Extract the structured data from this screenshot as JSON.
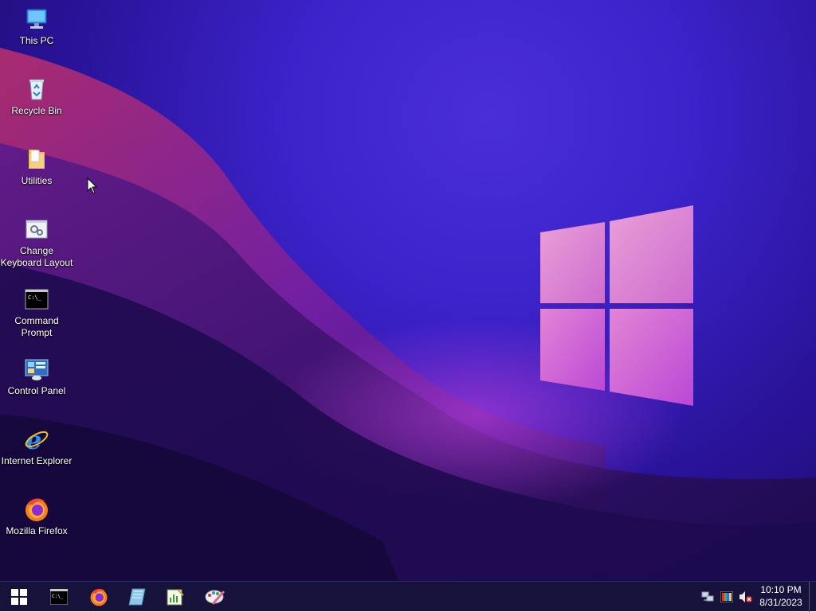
{
  "desktop_icons": [
    {
      "name": "this-pc",
      "label": "This PC",
      "icon": "computer-icon"
    },
    {
      "name": "recycle-bin",
      "label": "Recycle Bin",
      "icon": "recycle-bin-icon"
    },
    {
      "name": "utilities",
      "label": "Utilities",
      "icon": "folder-icon"
    },
    {
      "name": "change-keyboard-layout",
      "label": "Change\nKeyboard Layout",
      "icon": "settings-window-icon"
    },
    {
      "name": "command-prompt",
      "label": "Command\nPrompt",
      "icon": "cmd-icon"
    },
    {
      "name": "control-panel",
      "label": "Control Panel",
      "icon": "control-panel-icon"
    },
    {
      "name": "internet-explorer",
      "label": "Internet Explorer",
      "icon": "internet-explorer-icon"
    },
    {
      "name": "mozilla-firefox",
      "label": "Mozilla Firefox",
      "icon": "firefox-icon"
    }
  ],
  "taskbar": {
    "start_icon": "windows-logo-icon",
    "pinned": [
      "cmd-icon",
      "firefox-icon",
      "notebook-icon",
      "notepad-chart-icon",
      "paint-icon"
    ],
    "tray": [
      "network-icon",
      "color-app-icon",
      "volume-muted-icon"
    ],
    "time": "10:10 PM",
    "date": "8/31/2023"
  },
  "colors": {
    "wallpaper_base": "#3b22c9",
    "logo_pink": "#e88fd2",
    "taskbar": "#16123c"
  }
}
